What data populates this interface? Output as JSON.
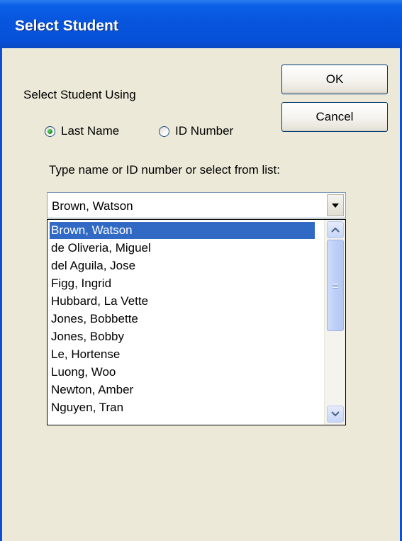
{
  "window": {
    "title": "Select Student"
  },
  "buttons": {
    "ok": "OK",
    "cancel": "Cancel"
  },
  "select_using": {
    "label": "Select Student Using",
    "options": [
      {
        "label": "Last Name",
        "checked": true
      },
      {
        "label": "ID Number",
        "checked": false
      }
    ]
  },
  "instruction": "Type name or ID number or select from list:",
  "combo": {
    "value": "Brown, Watson"
  },
  "list": {
    "items": [
      "Brown, Watson",
      "de Oliveria, Miguel",
      "del Aguila, Jose",
      "Figg, Ingrid",
      "Hubbard, La Vette",
      "Jones, Bobbette",
      "Jones, Bobby",
      "Le, Hortense",
      "Luong, Woo",
      "Newton, Amber",
      "Nguyen, Tran"
    ],
    "selected_index": 0
  },
  "colors": {
    "titlebar": "#0855dd",
    "dialog_background": "#ece9d8",
    "selection": "#316ac5",
    "radio_dot": "#21a121"
  }
}
